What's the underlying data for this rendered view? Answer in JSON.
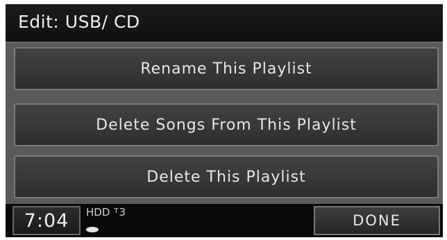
{
  "header": {
    "title": "Edit: USB/ CD"
  },
  "menu": {
    "items": [
      {
        "label": "Rename This Playlist"
      },
      {
        "label": "Delete Songs From This Playlist"
      },
      {
        "label": "Delete This Playlist"
      }
    ]
  },
  "status_bar": {
    "clock": "7:04",
    "source": "HDD",
    "track_symbol": "T",
    "track_number": "3",
    "done_label": "DONE"
  },
  "icons": {
    "track": "track-icon",
    "disc": "disc-icon"
  },
  "colors": {
    "background": "#0b0b0b",
    "menu_panel": "#5a5a5a",
    "button_fill": "#383838",
    "button_border": "#7a7a7a",
    "text": "#e6e6e6"
  }
}
